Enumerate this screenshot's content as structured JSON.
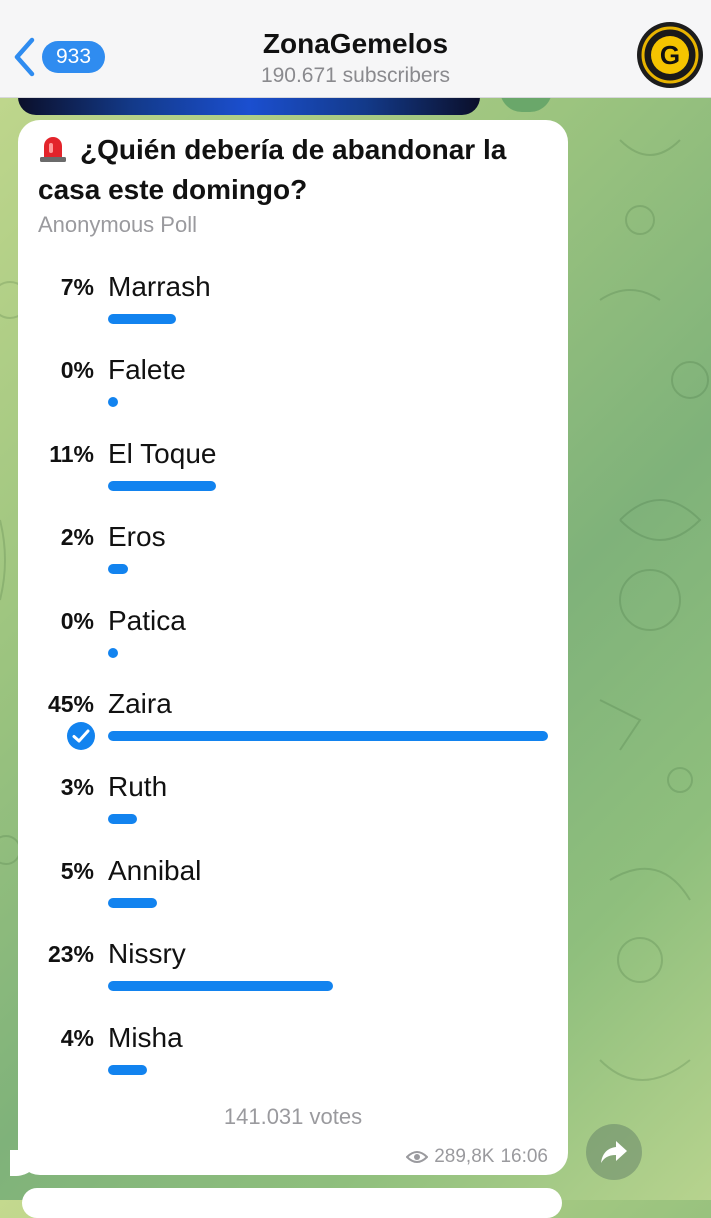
{
  "header": {
    "back_count": "933",
    "channel_name": "ZonaGemelos",
    "subscribers": "190.671 subscribers",
    "avatar_letter": "G"
  },
  "poll": {
    "question": "¿Quién debería de abandonar la casa este domingo?",
    "type": "Anonymous Poll",
    "options": [
      {
        "percent": "7%",
        "label": "Marrash",
        "value": 7
      },
      {
        "percent": "0%",
        "label": "Falete",
        "value": 0
      },
      {
        "percent": "11%",
        "label": "El Toque",
        "value": 11
      },
      {
        "percent": "2%",
        "label": "Eros",
        "value": 2
      },
      {
        "percent": "0%",
        "label": "Patica",
        "value": 0
      },
      {
        "percent": "45%",
        "label": "Zaira",
        "value": 45,
        "selected": true
      },
      {
        "percent": "3%",
        "label": "Ruth",
        "value": 3
      },
      {
        "percent": "5%",
        "label": "Annibal",
        "value": 5
      },
      {
        "percent": "23%",
        "label": "Nissry",
        "value": 23
      },
      {
        "percent": "4%",
        "label": "Misha",
        "value": 4
      }
    ],
    "votes": "141.031 votes",
    "views": "289,8K",
    "time": "16:06",
    "bar_color": "#1283ef"
  },
  "icons": {
    "siren": "siren-icon",
    "check": "check-circle-icon",
    "eye": "eye-icon",
    "share": "share-arrow-icon"
  }
}
